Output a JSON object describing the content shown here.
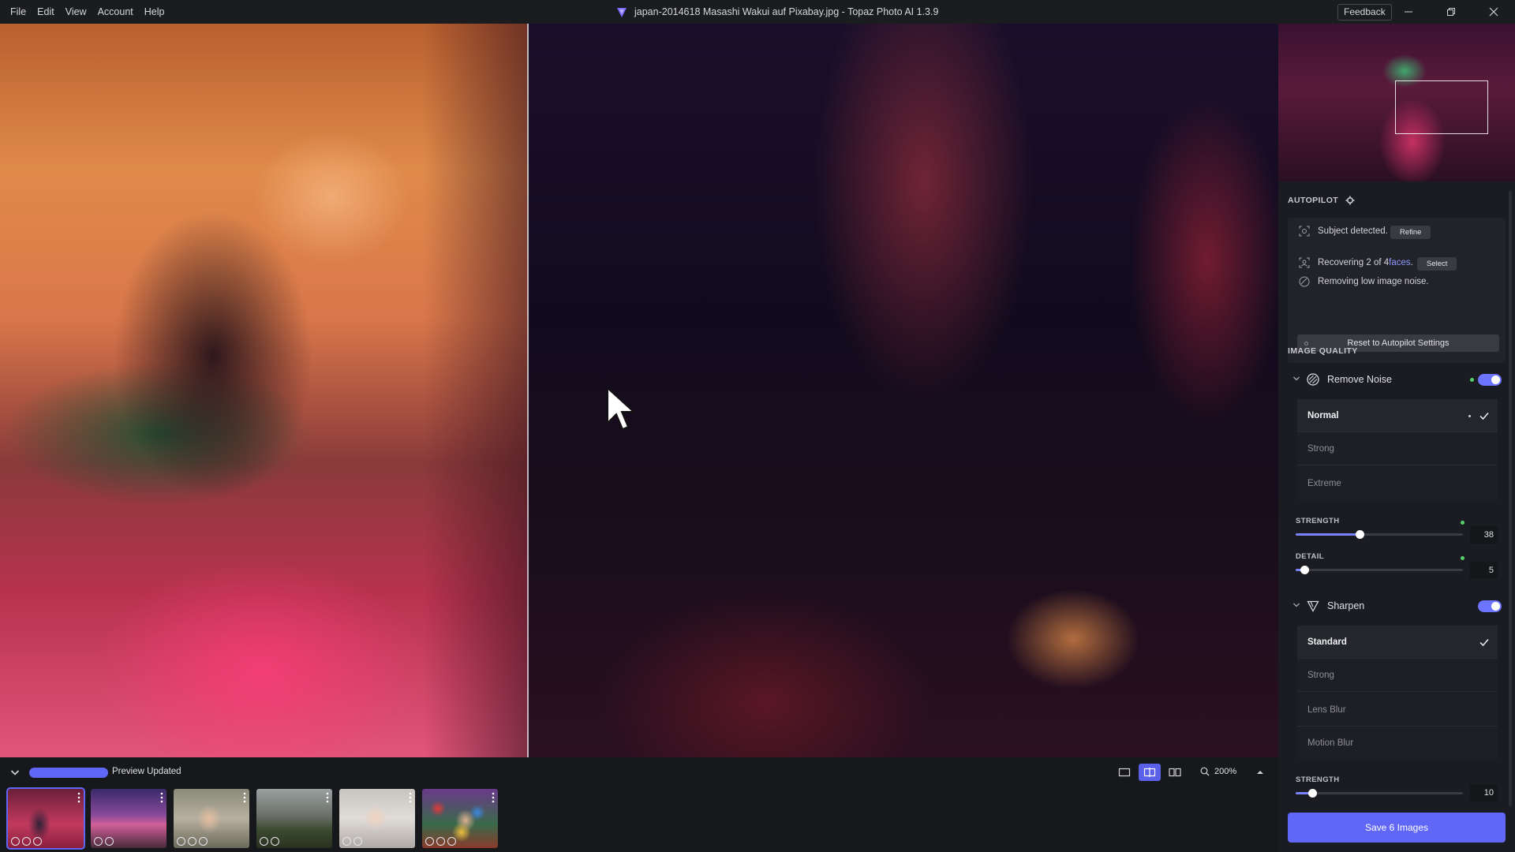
{
  "menu": [
    "File",
    "Edit",
    "View",
    "Account",
    "Help"
  ],
  "window": {
    "title": "japan-2014618 Masashi Wakui auf Pixabay.jpg - Topaz Photo AI 1.3.9",
    "feedback": "Feedback"
  },
  "autopilot": {
    "label": "AUTOPILOT",
    "subject": {
      "text": "Subject detected.",
      "button": "Refine"
    },
    "faces": {
      "prefix": "Recovering 2 of 4 ",
      "highlight": "faces",
      "suffix": ".",
      "button": "Select"
    },
    "noise": {
      "text": "Removing low image noise."
    },
    "reset": "Reset to Autopilot Settings"
  },
  "image_quality": {
    "label": "IMAGE QUALITY",
    "remove_noise": {
      "name": "Remove Noise",
      "modes": [
        "Normal",
        "Strong",
        "Extreme"
      ],
      "selected": "Normal",
      "strength": {
        "label": "STRENGTH",
        "value": "38",
        "fraction": 0.38
      },
      "detail": {
        "label": "DETAIL",
        "value": "5",
        "fraction": 0.05
      }
    },
    "sharpen": {
      "name": "Sharpen",
      "modes": [
        "Standard",
        "Strong",
        "Lens Blur",
        "Motion Blur"
      ],
      "selected": "Standard",
      "strength": {
        "label": "STRENGTH",
        "value": "10",
        "fraction": 0.1
      }
    }
  },
  "save_button": "Save 6 Images",
  "bottom": {
    "status": "Preview Updated",
    "zoom": "200%",
    "thumbnail_count": 6
  },
  "colors": {
    "accent": "#6066f5",
    "toggle": "#6d74ff",
    "ok_dot": "#58d06a",
    "highlight": "#8f98ff"
  }
}
